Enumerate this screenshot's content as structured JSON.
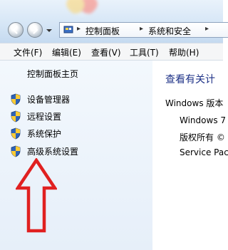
{
  "window": {
    "address_bar": {
      "crumbs": [
        "控制面板",
        "系统和安全"
      ],
      "separator": "▸"
    }
  },
  "menu": {
    "items": [
      "文件(F)",
      "编辑(E)",
      "查看(V)",
      "工具(T)",
      "帮助(H)"
    ]
  },
  "left_pane": {
    "home_link": "控制面板主页",
    "tasks": [
      {
        "label": "设备管理器",
        "icon": "shield-icon"
      },
      {
        "label": "远程设置",
        "icon": "shield-icon"
      },
      {
        "label": "系统保护",
        "icon": "shield-icon"
      },
      {
        "label": "高级系统设置",
        "icon": "shield-icon"
      }
    ]
  },
  "right_pane": {
    "title": "查看有关计",
    "windows_edition_label": "Windows 版本",
    "os_name": "Windows 7",
    "copyright": "版权所有 ©",
    "service_pack": "Service Pac"
  },
  "colors": {
    "annotation_arrow": "#e02020",
    "title_blue": "#1e3287"
  }
}
